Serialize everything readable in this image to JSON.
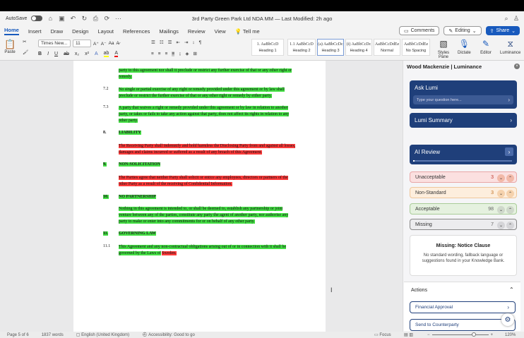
{
  "titlebar": {
    "autosave": "AutoSave",
    "title": "3rd Party Green Park Ltd NDA MM — Last Modified: 2h ago"
  },
  "tabs": [
    "Home",
    "Insert",
    "Draw",
    "Design",
    "Layout",
    "References",
    "Mailings",
    "Review",
    "View",
    "Tell me"
  ],
  "tabs_right": {
    "comments": "Comments",
    "editing": "Editing",
    "share": "Share"
  },
  "ribbon": {
    "paste": "Paste",
    "font": "Times New...",
    "size": "11",
    "styles": [
      {
        "preview": "1. AaBbCcD",
        "name": "Heading 1"
      },
      {
        "preview": "1.1 AaBbCcD",
        "name": "Heading 2"
      },
      {
        "preview": "(a) AaBbCcDc",
        "name": "Heading 3"
      },
      {
        "preview": "(i) AaBbCcDc",
        "name": "Heading 4"
      },
      {
        "preview": "AaBbCcDdEe",
        "name": "Normal"
      },
      {
        "preview": "AaBbCcDdEe",
        "name": "No Spacing"
      }
    ],
    "buttons": [
      "Styles Pane",
      "Dictate",
      "Editor",
      "Luminance"
    ]
  },
  "doc": {
    "p0": "party to this agreement nor shall it preclude or restrict any further exercise of that or any other right or remedy.",
    "n72": "7.2",
    "p72": "No single or partial exercise of any right or remedy provided under this agreement or by law shall preclude or restrict the further exercise of that or any other right or remedy by either party.",
    "n73": "7.3",
    "p73": "A party that waives a right or remedy provided under this agreement or by law in relation to another party, or takes or fails to take any action against that party, does not affect its rights in relation to any other party.",
    "n8": "8.",
    "h8": "LIABILITY",
    "p8": "The Receiving Party shall indemnify and hold harmless the Disclosing Party from and against all losses, damages and claims incurred or suffered as a result of any breach of this Agreement.",
    "n9": "9.",
    "h9": "NON-SOLICITATION",
    "p9": "The Parties agree that neither Party shall solicit or entice any employees, directors or partners of the other Party as a result of the receiving of Confidential Information.",
    "n10": "10.",
    "h10": "NO PARTNERSHIP",
    "p10": "Nothing in this agreement is intended to, or shall be deemed to, establish any partnership or joint venture between any of the parties, constitute any party the agent of another party, nor authorise any party to make or enter into any commitments for or on behalf of any other party.",
    "n11": "11.",
    "h11": "GOVERNING LAW",
    "n111": "11.1",
    "p111a": "This Agreement and any non-contractual obligations arising out of or in connection with it shall be governed by the Laws of",
    "p111b": "Sweden."
  },
  "status": {
    "page": "Page 5 of 6",
    "words": "1837 words",
    "lang": "English (United Kingdom)",
    "access": "Accessibility: Good to go",
    "focus": "Focus",
    "zoom": "120%"
  },
  "panel": {
    "title": "Wood Mackenzie | Luminance",
    "ask": "Ask Lumi",
    "ask_ph": "Type your question here...",
    "summary": "Lumi Summary",
    "review": "AI Review",
    "rows": [
      {
        "label": "Unacceptable",
        "count": "3",
        "bg": "#fbe0e0",
        "border": "#e9a6a6",
        "chip": "#f2b9a8"
      },
      {
        "label": "Non-Standard",
        "count": "3",
        "bg": "#fdeedd",
        "border": "#efc79b",
        "chip": "#f5d2ad"
      },
      {
        "label": "Acceptable",
        "count": "98",
        "bg": "#e5f1df",
        "border": "#a9cc98",
        "chip": "#cfd8cb"
      },
      {
        "label": "Missing",
        "count": "7",
        "bg": "#ececee",
        "border": "#888",
        "chip": "#d5d5d8"
      }
    ],
    "missing_title": "Missing: Notice Clause",
    "missing_text": "No standard wording, fallback language or suggestions found in your Knowledge Bank.",
    "actions": "Actions",
    "action_items": [
      "Financial Approval",
      "Send to Counterparty"
    ]
  }
}
